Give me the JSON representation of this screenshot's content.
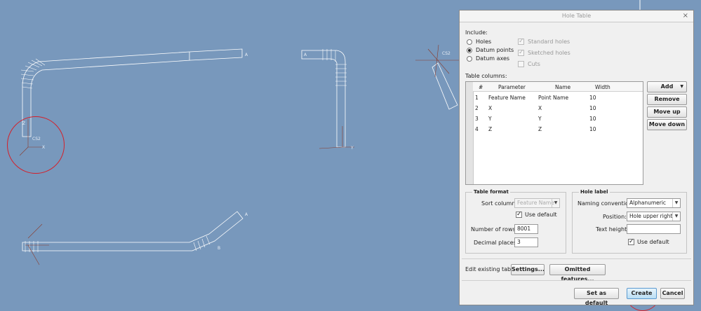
{
  "dialog": {
    "title": "Hole Table",
    "close": "×",
    "include_label": "Include:",
    "radios": [
      {
        "label": "Holes",
        "selected": false
      },
      {
        "label": "Datum points",
        "selected": true
      },
      {
        "label": "Datum axes",
        "selected": false
      }
    ],
    "checks": [
      {
        "label": "Standard holes",
        "checked": true,
        "disabled": true
      },
      {
        "label": "Sketched holes",
        "checked": true,
        "disabled": true
      },
      {
        "label": "Cuts",
        "checked": false,
        "disabled": true
      }
    ],
    "table_columns_label": "Table columns:",
    "table": {
      "headers": [
        "#",
        "Parameter",
        "Name",
        "Width"
      ],
      "rows": [
        [
          "1",
          "Feature Name",
          "Point Name",
          "10"
        ],
        [
          "2",
          "X",
          "X",
          "10"
        ],
        [
          "3",
          "Y",
          "Y",
          "10"
        ],
        [
          "4",
          "Z",
          "Z",
          "10"
        ]
      ]
    },
    "side_buttons": {
      "add": "Add",
      "remove": "Remove",
      "move_up": "Move up",
      "move_down": "Move down"
    },
    "table_format": {
      "title": "Table format",
      "sort_label": "Sort column:",
      "sort_value": "Feature Name",
      "use_default": "Use default",
      "use_default_checked": true,
      "rows_label": "Number of rows:",
      "rows_value": "8001",
      "decimals_label": "Decimal places:",
      "decimals_value": "3"
    },
    "hole_label": {
      "title": "Hole label",
      "naming_label": "Naming convention:",
      "naming_value": "Alphanumeric",
      "position_label": "Position:",
      "position_value": "Hole upper right",
      "text_height_label": "Text height:",
      "text_height_value": "",
      "use_default": "Use default",
      "use_default_checked": true
    },
    "edit_label": "Edit existing table:",
    "settings_button": "Settings...",
    "omitted_button": "Omitted features...",
    "footer": {
      "set_default": "Set as default",
      "create": "Create",
      "cancel": "Cancel"
    }
  },
  "canvas": {
    "labels": {
      "a1": "A",
      "a2": "A",
      "a3": "A",
      "b3": "B",
      "cs_left": "CS2",
      "cs_right": "CS2",
      "z": "Z",
      "x": "X",
      "y": "Y"
    }
  },
  "colors": {
    "background": "#7898bc",
    "annotation": "#d4202a",
    "primary_button": "#b9ddf4"
  }
}
